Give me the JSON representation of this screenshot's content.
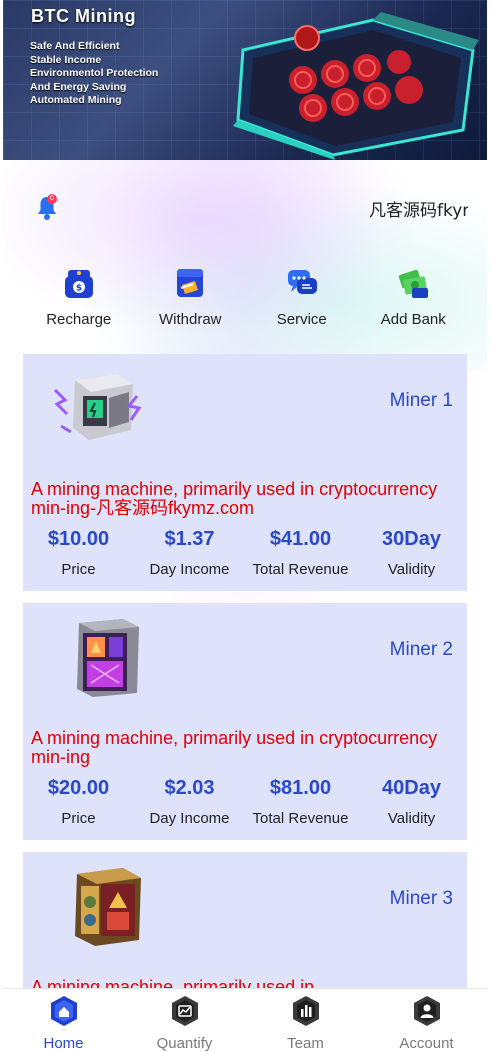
{
  "banner": {
    "title": "BTC Mining",
    "lines": [
      "Safe And Efficient",
      "Stable Income",
      "Environmentol Protection",
      "And Energy Saving",
      "Automated Mining"
    ]
  },
  "notice": {
    "badge": "0",
    "marquee_text": "凡客源码fkymz.com"
  },
  "actions": [
    {
      "label": "Recharge",
      "icon": "recharge-icon"
    },
    {
      "label": "Withdraw",
      "icon": "withdraw-icon"
    },
    {
      "label": "Service",
      "icon": "service-icon"
    },
    {
      "label": "Add Bank",
      "icon": "add-bank-icon"
    }
  ],
  "stat_labels": {
    "price": "Price",
    "day_income": "Day Income",
    "total_revenue": "Total Revenue",
    "validity": "Validity"
  },
  "products": [
    {
      "name": "Miner 1",
      "description": "A mining machine, primarily used in cryptocurrency min-ing-凡客源码fkymz.com",
      "price": "$10.00",
      "day_income": "$1.37",
      "total_revenue": "$41.00",
      "validity": "30Day"
    },
    {
      "name": "Miner 2",
      "description": "A mining machine, primarily used in cryptocurrency min-ing",
      "price": "$20.00",
      "day_income": "$2.03",
      "total_revenue": "$81.00",
      "validity": "40Day"
    },
    {
      "name": "Miner 3",
      "description": "A mining machine, primarily used in",
      "price": "",
      "day_income": "",
      "total_revenue": "",
      "validity": ""
    }
  ],
  "tabbar": {
    "items": [
      {
        "label": "Home",
        "active": true
      },
      {
        "label": "Quantify",
        "active": false
      },
      {
        "label": "Team",
        "active": false
      },
      {
        "label": "Account",
        "active": false
      }
    ]
  },
  "colors": {
    "accent": "#2a48c7",
    "card_bg": "#dee3fb",
    "description": "#e00000"
  }
}
